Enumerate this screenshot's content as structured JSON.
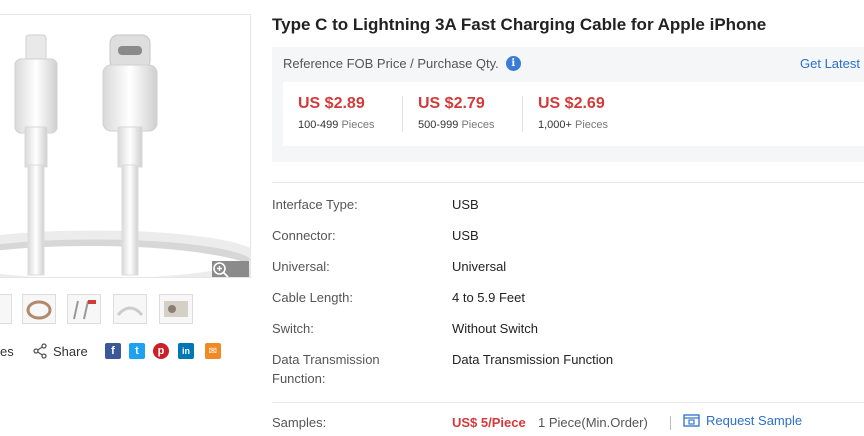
{
  "product": {
    "title": "Type C to Lightning 3A Fast Charging Cable for Apple iPhone"
  },
  "price": {
    "header": "Reference FOB Price / Purchase Qty.",
    "info_icon": "i",
    "get_latest": "Get Latest",
    "tiers": [
      {
        "price": "US $2.89",
        "qty": "100-499",
        "unit": "Pieces"
      },
      {
        "price": "US $2.79",
        "qty": "500-999",
        "unit": "Pieces"
      },
      {
        "price": "US $2.69",
        "qty": "1,000+",
        "unit": "Pieces"
      }
    ]
  },
  "specs": [
    {
      "label": "Interface Type:",
      "value": "USB"
    },
    {
      "label": "Connector:",
      "value": "USB"
    },
    {
      "label": "Universal:",
      "value": "Universal"
    },
    {
      "label": "Cable Length:",
      "value": "4 to 5.9 Feet"
    },
    {
      "label": "Switch:",
      "value": "Without Switch"
    },
    {
      "label": "Data Transmission",
      "label2": "Function:",
      "value": "Data Transmission Function"
    }
  ],
  "samples": {
    "label": "Samples:",
    "price": "US$ 5/Piece",
    "qty": "1 Piece(Min.Order)",
    "request": "Request Sample"
  },
  "share": {
    "favorites_fragment": "es",
    "share_label": "Share",
    "icons": [
      {
        "name": "facebook-icon",
        "glyph": "f",
        "color": "#3b5998"
      },
      {
        "name": "twitter-icon",
        "glyph": "t",
        "color": "#1da1f2"
      },
      {
        "name": "pinterest-icon",
        "glyph": "p",
        "color": "#cb2027"
      },
      {
        "name": "linkedin-icon",
        "glyph": "in",
        "color": "#0077b5"
      },
      {
        "name": "email-icon",
        "glyph": "✉",
        "color": "#f08a24"
      }
    ]
  },
  "colors": {
    "price_red": "#d33a3a",
    "link_blue": "#2b6fcb",
    "panel_bg": "#f5f6f8"
  }
}
